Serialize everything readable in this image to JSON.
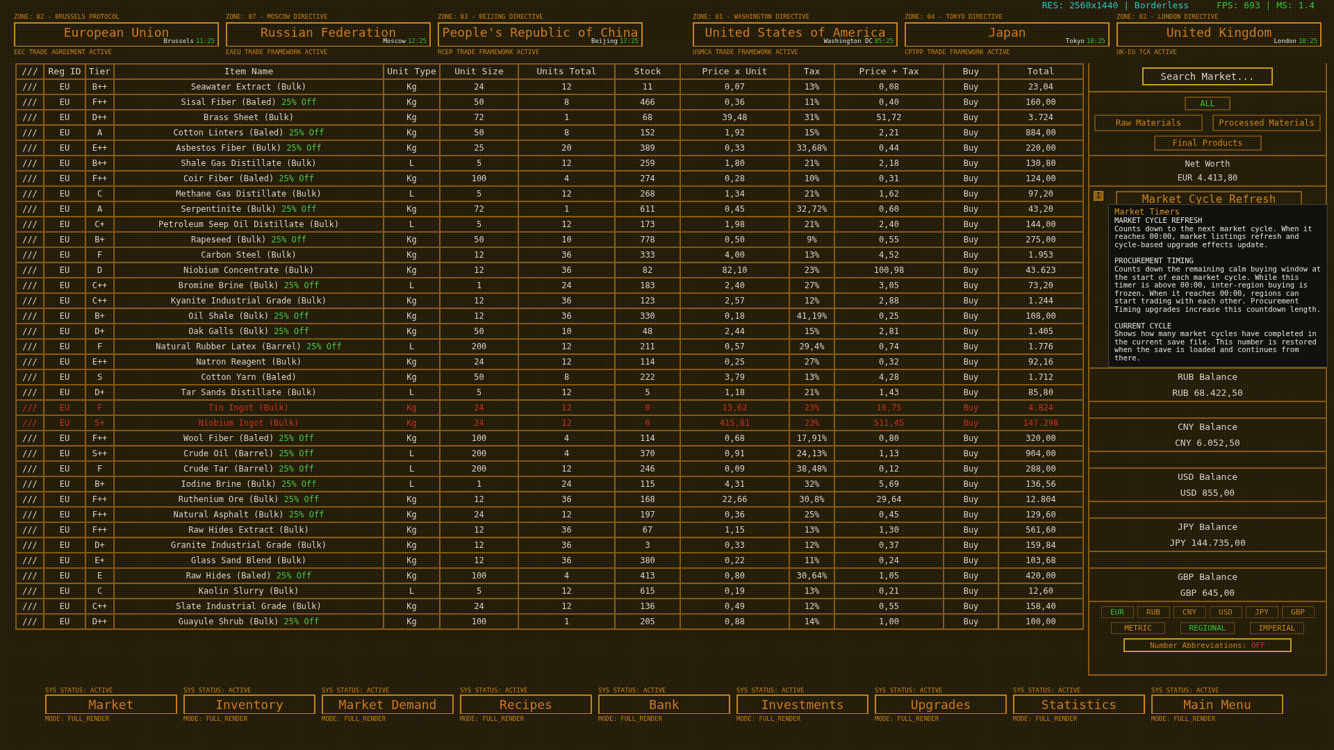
{
  "status": {
    "resolution": "RES: 2560x1440 | Borderless",
    "performance": "FPS: 693 | MS: 1.4"
  },
  "zones": [
    {
      "label": "ZONE: 02 - BRUSSELS PROTOCOL",
      "name": "European Union",
      "city": "Brussels",
      "time": "11:25",
      "agreement": "EEC TRADE AGREEMENT ACTIVE"
    },
    {
      "label": "ZONE: 07 - MOSCOW DIRECTIVE",
      "name": "Russian Federation",
      "city": "Moscow",
      "time": "12:25",
      "agreement": "EAEU TRADE FRAMEWORK ACTIVE"
    },
    {
      "label": "ZONE: 03 - BEIJING DIRECTIVE",
      "name": "People's Republic of China",
      "city": "Beijing",
      "time": "17:25",
      "agreement": "RCEP TRADE FRAMEWORK ACTIVE"
    },
    {
      "label": "ZONE: 01 - WASHINGTON DIRECTIVE",
      "name": "United States of America",
      "city": "Washington DC",
      "time": "05:25",
      "agreement": "USMCA TRADE FRAMEWORK ACTIVE"
    },
    {
      "label": "ZONE: 04 - TOKYO DIRECTIVE",
      "name": "Japan",
      "city": "Tokyo",
      "time": "18:25",
      "agreement": "CPTPP TRADE FRAMEWORK ACTIVE"
    },
    {
      "label": "ZONE: 02 - LONDON DIRECTIVE",
      "name": "United Kingdom",
      "city": "London",
      "time": "10:25",
      "agreement": "UK-EU TCA ACTIVE"
    }
  ],
  "table": {
    "columns": [
      "///",
      "Reg ID",
      "Tier",
      "Item Name",
      "Unit Type",
      "Unit Size",
      "Units Total",
      "Stock",
      "Price x Unit",
      "Tax",
      "Price + Tax",
      "Buy",
      "Total"
    ],
    "rows": [
      {
        "marker": "///",
        "region": "EU",
        "tier": "B++",
        "item": "Seawater Extract (Bulk)",
        "unit_type": "Kg",
        "unit_size": "24",
        "units_total": "12",
        "stock": "11",
        "price": "0,07",
        "tax": "13%",
        "price_tax": "0,08",
        "buy": "Buy",
        "total": "23,04",
        "out_of_stock": false
      },
      {
        "marker": "///",
        "region": "EU",
        "tier": "F++",
        "item": "Sisal Fiber (Baled)",
        "discount": "25% Off",
        "unit_type": "Kg",
        "unit_size": "50",
        "units_total": "8",
        "stock": "466",
        "price": "0,36",
        "tax": "11%",
        "price_tax": "0,40",
        "buy": "Buy",
        "total": "160,00",
        "out_of_stock": false
      },
      {
        "marker": "///",
        "region": "EU",
        "tier": "D++",
        "item": "Brass Sheet (Bulk)",
        "unit_type": "Kg",
        "unit_size": "72",
        "units_total": "1",
        "stock": "68",
        "price": "39,48",
        "tax": "31%",
        "price_tax": "51,72",
        "buy": "Buy",
        "total": "3.724",
        "out_of_stock": false
      },
      {
        "marker": "///",
        "region": "EU",
        "tier": "A",
        "item": "Cotton Linters (Baled)",
        "discount": "25% Off",
        "unit_type": "Kg",
        "unit_size": "50",
        "units_total": "8",
        "stock": "152",
        "price": "1,92",
        "tax": "15%",
        "price_tax": "2,21",
        "buy": "Buy",
        "total": "884,00",
        "out_of_stock": false
      },
      {
        "marker": "///",
        "region": "EU",
        "tier": "E++",
        "item": "Asbestos Fiber (Bulk)",
        "discount": "25% Off",
        "unit_type": "Kg",
        "unit_size": "25",
        "units_total": "20",
        "stock": "389",
        "price": "0,33",
        "tax": "33,68%",
        "price_tax": "0,44",
        "buy": "Buy",
        "total": "220,00",
        "out_of_stock": false
      },
      {
        "marker": "///",
        "region": "EU",
        "tier": "B++",
        "item": "Shale Gas Distillate (Bulk)",
        "unit_type": "L",
        "unit_size": "5",
        "units_total": "12",
        "stock": "259",
        "price": "1,80",
        "tax": "21%",
        "price_tax": "2,18",
        "buy": "Buy",
        "total": "130,80",
        "out_of_stock": false
      },
      {
        "marker": "///",
        "region": "EU",
        "tier": "F++",
        "item": "Coir Fiber (Baled)",
        "discount": "25% Off",
        "unit_type": "Kg",
        "unit_size": "100",
        "units_total": "4",
        "stock": "274",
        "price": "0,28",
        "tax": "10%",
        "price_tax": "0,31",
        "buy": "Buy",
        "total": "124,00",
        "out_of_stock": false
      },
      {
        "marker": "///",
        "region": "EU",
        "tier": "C",
        "item": "Methane Gas Distillate (Bulk)",
        "unit_type": "L",
        "unit_size": "5",
        "units_total": "12",
        "stock": "268",
        "price": "1,34",
        "tax": "21%",
        "price_tax": "1,62",
        "buy": "Buy",
        "total": "97,20",
        "out_of_stock": false
      },
      {
        "marker": "///",
        "region": "EU",
        "tier": "A",
        "item": "Serpentinite (Bulk)",
        "discount": "25% Off",
        "unit_type": "Kg",
        "unit_size": "72",
        "units_total": "1",
        "stock": "611",
        "price": "0,45",
        "tax": "32,72%",
        "price_tax": "0,60",
        "buy": "Buy",
        "total": "43,20",
        "out_of_stock": false
      },
      {
        "marker": "///",
        "region": "EU",
        "tier": "C+",
        "item": "Petroleum Seep Oil Distillate (Bulk)",
        "unit_type": "L",
        "unit_size": "5",
        "units_total": "12",
        "stock": "173",
        "price": "1,98",
        "tax": "21%",
        "price_tax": "2,40",
        "buy": "Buy",
        "total": "144,00",
        "out_of_stock": false
      },
      {
        "marker": "///",
        "region": "EU",
        "tier": "B+",
        "item": "Rapeseed (Bulk)",
        "discount": "25% Off",
        "unit_type": "Kg",
        "unit_size": "50",
        "units_total": "10",
        "stock": "778",
        "price": "0,50",
        "tax": "9%",
        "price_tax": "0,55",
        "buy": "Buy",
        "total": "275,00",
        "out_of_stock": false
      },
      {
        "marker": "///",
        "region": "EU",
        "tier": "F",
        "item": "Carbon Steel (Bulk)",
        "unit_type": "Kg",
        "unit_size": "12",
        "units_total": "36",
        "stock": "333",
        "price": "4,00",
        "tax": "13%",
        "price_tax": "4,52",
        "buy": "Buy",
        "total": "1.953",
        "out_of_stock": false
      },
      {
        "marker": "///",
        "region": "EU",
        "tier": "D",
        "item": "Niobium Concentrate (Bulk)",
        "unit_type": "Kg",
        "unit_size": "12",
        "units_total": "36",
        "stock": "82",
        "price": "82,10",
        "tax": "23%",
        "price_tax": "100,98",
        "buy": "Buy",
        "total": "43.623",
        "out_of_stock": false
      },
      {
        "marker": "///",
        "region": "EU",
        "tier": "C++",
        "item": "Bromine Brine (Bulk)",
        "discount": "25% Off",
        "unit_type": "L",
        "unit_size": "1",
        "units_total": "24",
        "stock": "183",
        "price": "2,40",
        "tax": "27%",
        "price_tax": "3,05",
        "buy": "Buy",
        "total": "73,20",
        "out_of_stock": false
      },
      {
        "marker": "///",
        "region": "EU",
        "tier": "C++",
        "item": "Kyanite Industrial Grade (Bulk)",
        "unit_type": "Kg",
        "unit_size": "12",
        "units_total": "36",
        "stock": "123",
        "price": "2,57",
        "tax": "12%",
        "price_tax": "2,88",
        "buy": "Buy",
        "total": "1.244",
        "out_of_stock": false
      },
      {
        "marker": "///",
        "region": "EU",
        "tier": "B+",
        "item": "Oil Shale (Bulk)",
        "discount": "25% Off",
        "unit_type": "Kg",
        "unit_size": "12",
        "units_total": "36",
        "stock": "330",
        "price": "0,18",
        "tax": "41,19%",
        "price_tax": "0,25",
        "buy": "Buy",
        "total": "108,00",
        "out_of_stock": false
      },
      {
        "marker": "///",
        "region": "EU",
        "tier": "D+",
        "item": "Oak Galls (Bulk)",
        "discount": "25% Off",
        "unit_type": "Kg",
        "unit_size": "50",
        "units_total": "10",
        "stock": "48",
        "price": "2,44",
        "tax": "15%",
        "price_tax": "2,81",
        "buy": "Buy",
        "total": "1.405",
        "out_of_stock": false
      },
      {
        "marker": "///",
        "region": "EU",
        "tier": "F",
        "item": "Natural Rubber Latex (Barrel)",
        "discount": "25% Off",
        "unit_type": "L",
        "unit_size": "200",
        "units_total": "12",
        "stock": "211",
        "price": "0,57",
        "tax": "29,4%",
        "price_tax": "0,74",
        "buy": "Buy",
        "total": "1.776",
        "out_of_stock": false
      },
      {
        "marker": "///",
        "region": "EU",
        "tier": "E++",
        "item": "Natron Reagent (Bulk)",
        "unit_type": "Kg",
        "unit_size": "24",
        "units_total": "12",
        "stock": "114",
        "price": "0,25",
        "tax": "27%",
        "price_tax": "0,32",
        "buy": "Buy",
        "total": "92,16",
        "out_of_stock": false
      },
      {
        "marker": "///",
        "region": "EU",
        "tier": "S",
        "item": "Cotton Yarn (Baled)",
        "unit_type": "Kg",
        "unit_size": "50",
        "units_total": "8",
        "stock": "222",
        "price": "3,79",
        "tax": "13%",
        "price_tax": "4,28",
        "buy": "Buy",
        "total": "1.712",
        "out_of_stock": false
      },
      {
        "marker": "///",
        "region": "EU",
        "tier": "D+",
        "item": "Tar Sands Distillate (Bulk)",
        "unit_type": "L",
        "unit_size": "5",
        "units_total": "12",
        "stock": "5",
        "price": "1,18",
        "tax": "21%",
        "price_tax": "1,43",
        "buy": "Buy",
        "total": "85,80",
        "out_of_stock": false
      },
      {
        "marker": "///",
        "region": "EU",
        "tier": "F",
        "item": "Tin Ingot (Bulk)",
        "unit_type": "Kg",
        "unit_size": "24",
        "units_total": "12",
        "stock": "0",
        "price": "13,62",
        "tax": "23%",
        "price_tax": "16,75",
        "buy": "Buy",
        "total": "4.824",
        "out_of_stock": true
      },
      {
        "marker": "///",
        "region": "EU",
        "tier": "S+",
        "item": "Niobium Ingot (Bulk)",
        "unit_type": "Kg",
        "unit_size": "24",
        "units_total": "12",
        "stock": "0",
        "price": "415,81",
        "tax": "23%",
        "price_tax": "511,45",
        "buy": "Buy",
        "total": "147.298",
        "out_of_stock": true
      },
      {
        "marker": "///",
        "region": "EU",
        "tier": "F++",
        "item": "Wool Fiber (Baled)",
        "discount": "25% Off",
        "unit_type": "Kg",
        "unit_size": "100",
        "units_total": "4",
        "stock": "114",
        "price": "0,68",
        "tax": "17,91%",
        "price_tax": "0,80",
        "buy": "Buy",
        "total": "320,00",
        "out_of_stock": false
      },
      {
        "marker": "///",
        "region": "EU",
        "tier": "S++",
        "item": "Crude Oil (Barrel)",
        "discount": "25% Off",
        "unit_type": "L",
        "unit_size": "200",
        "units_total": "4",
        "stock": "370",
        "price": "0,91",
        "tax": "24,13%",
        "price_tax": "1,13",
        "buy": "Buy",
        "total": "904,00",
        "out_of_stock": false
      },
      {
        "marker": "///",
        "region": "EU",
        "tier": "F",
        "item": "Crude Tar (Barrel)",
        "discount": "25% Off",
        "unit_type": "L",
        "unit_size": "200",
        "units_total": "12",
        "stock": "246",
        "price": "0,09",
        "tax": "38,48%",
        "price_tax": "0,12",
        "buy": "Buy",
        "total": "288,00",
        "out_of_stock": false
      },
      {
        "marker": "///",
        "region": "EU",
        "tier": "B+",
        "item": "Iodine Brine (Bulk)",
        "discount": "25% Off",
        "unit_type": "L",
        "unit_size": "1",
        "units_total": "24",
        "stock": "115",
        "price": "4,31",
        "tax": "32%",
        "price_tax": "5,69",
        "buy": "Buy",
        "total": "136,56",
        "out_of_stock": false
      },
      {
        "marker": "///",
        "region": "EU",
        "tier": "F++",
        "item": "Ruthenium Ore (Bulk)",
        "discount": "25% Off",
        "unit_type": "Kg",
        "unit_size": "12",
        "units_total": "36",
        "stock": "168",
        "price": "22,66",
        "tax": "30,8%",
        "price_tax": "29,64",
        "buy": "Buy",
        "total": "12.804",
        "out_of_stock": false
      },
      {
        "marker": "///",
        "region": "EU",
        "tier": "F++",
        "item": "Natural Asphalt (Bulk)",
        "discount": "25% Off",
        "unit_type": "Kg",
        "unit_size": "24",
        "units_total": "12",
        "stock": "197",
        "price": "0,36",
        "tax": "25%",
        "price_tax": "0,45",
        "buy": "Buy",
        "total": "129,60",
        "out_of_stock": false
      },
      {
        "marker": "///",
        "region": "EU",
        "tier": "F++",
        "item": "Raw Hides Extract (Bulk)",
        "unit_type": "Kg",
        "unit_size": "12",
        "units_total": "36",
        "stock": "67",
        "price": "1,15",
        "tax": "13%",
        "price_tax": "1,30",
        "buy": "Buy",
        "total": "561,60",
        "out_of_stock": false
      },
      {
        "marker": "///",
        "region": "EU",
        "tier": "D+",
        "item": "Granite Industrial Grade (Bulk)",
        "unit_type": "Kg",
        "unit_size": "12",
        "units_total": "36",
        "stock": "3",
        "price": "0,33",
        "tax": "12%",
        "price_tax": "0,37",
        "buy": "Buy",
        "total": "159,84",
        "out_of_stock": false
      },
      {
        "marker": "///",
        "region": "EU",
        "tier": "E+",
        "item": "Glass Sand Blend (Bulk)",
        "unit_type": "Kg",
        "unit_size": "12",
        "units_total": "36",
        "stock": "380",
        "price": "0,22",
        "tax": "11%",
        "price_tax": "0,24",
        "buy": "Buy",
        "total": "103,68",
        "out_of_stock": false
      },
      {
        "marker": "///",
        "region": "EU",
        "tier": "E",
        "item": "Raw Hides (Baled)",
        "discount": "25% Off",
        "unit_type": "Kg",
        "unit_size": "100",
        "units_total": "4",
        "stock": "413",
        "price": "0,80",
        "tax": "30,64%",
        "price_tax": "1,05",
        "buy": "Buy",
        "total": "420,00",
        "out_of_stock": false
      },
      {
        "marker": "///",
        "region": "EU",
        "tier": "C",
        "item": "Kaolin Slurry (Bulk)",
        "unit_type": "L",
        "unit_size": "5",
        "units_total": "12",
        "stock": "615",
        "price": "0,19",
        "tax": "13%",
        "price_tax": "0,21",
        "buy": "Buy",
        "total": "12,60",
        "out_of_stock": false
      },
      {
        "marker": "///",
        "region": "EU",
        "tier": "C++",
        "item": "Slate Industrial Grade (Bulk)",
        "unit_type": "Kg",
        "unit_size": "24",
        "units_total": "12",
        "stock": "136",
        "price": "0,49",
        "tax": "12%",
        "price_tax": "0,55",
        "buy": "Buy",
        "total": "158,40",
        "out_of_stock": false
      },
      {
        "marker": "///",
        "region": "EU",
        "tier": "D++",
        "item": "Guayule Shrub (Bulk)",
        "discount": "25% Off",
        "unit_type": "Kg",
        "unit_size": "100",
        "units_total": "1",
        "stock": "205",
        "price": "0,88",
        "tax": "14%",
        "price_tax": "1,00",
        "buy": "Buy",
        "total": "100,00",
        "out_of_stock": false
      }
    ]
  },
  "sidebar": {
    "search": {
      "placeholder": "Search Market..."
    },
    "filters": [
      {
        "label": "ALL",
        "selected": true
      },
      {
        "label": "Raw Materials",
        "selected": false
      },
      {
        "label": "Processed Materials",
        "selected": false
      },
      {
        "label": "Final Products",
        "selected": false
      }
    ],
    "net_worth": {
      "label": "Net Worth",
      "value": "EUR 4.413,80"
    },
    "info_button": "I",
    "cycle_button": "Market Cycle Refresh",
    "tooltip": {
      "title": "Market Timers",
      "sections": [
        {
          "heading": "MARKET CYCLE REFRESH",
          "body": "Counts down to the next market cycle. When it reaches 00:00, market listings refresh and cycle-based upgrade effects update."
        },
        {
          "heading": "PROCUREMENT TIMING",
          "body": "Counts down the remaining calm buying window at the start of each market cycle. While this timer is above 00:00, inter-region buying is frozen. When it reaches 00:00, regions can start trading with each other. Procurement Timing upgrades increase this countdown length."
        },
        {
          "heading": "CURRENT CYCLE",
          "body": "Shows how many market cycles have completed in the current save file. This number is restored when the save is loaded and continues from there."
        }
      ]
    },
    "balances": [
      {
        "label": "RUB Balance",
        "value": "RUB 68.422,50"
      },
      {
        "label": "CNY Balance",
        "value": "CNY 6.052,50"
      },
      {
        "label": "USD Balance",
        "value": "USD 855,00"
      },
      {
        "label": "JPY Balance",
        "value": "JPY 144.735,00"
      },
      {
        "label": "GBP Balance",
        "value": "GBP 645,00"
      }
    ],
    "currencies": [
      {
        "label": "EUR",
        "selected": true
      },
      {
        "label": "RUB",
        "selected": false
      },
      {
        "label": "CNY",
        "selected": false
      },
      {
        "label": "USD",
        "selected": false
      },
      {
        "label": "JPY",
        "selected": false
      },
      {
        "label": "GBP",
        "selected": false
      }
    ],
    "units": [
      {
        "label": "METRIC",
        "selected": false
      },
      {
        "label": "REGIONAL",
        "selected": true
      },
      {
        "label": "IMPERIAL",
        "selected": false
      }
    ],
    "abbreviations": {
      "label": "Number Abbreviations:",
      "value": "OFF",
      "on": false
    }
  },
  "nav": [
    {
      "status": "SYS STATUS: ACTIVE",
      "label": "Market",
      "mode": "MODE: FULL_RENDER"
    },
    {
      "status": "SYS STATUS: ACTIVE",
      "label": "Inventory",
      "mode": "MODE: FULL_RENDER"
    },
    {
      "status": "SYS STATUS: ACTIVE",
      "label": "Market Demand",
      "mode": "MODE: FULL_RENDER"
    },
    {
      "status": "SYS STATUS: ACTIVE",
      "label": "Recipes",
      "mode": "MODE: FULL_RENDER"
    },
    {
      "status": "SYS STATUS: ACTIVE",
      "label": "Bank",
      "mode": "MODE: FULL_RENDER"
    },
    {
      "status": "SYS STATUS: ACTIVE",
      "label": "Investments",
      "mode": "MODE: FULL_RENDER"
    },
    {
      "status": "SYS STATUS: ACTIVE",
      "label": "Upgrades",
      "mode": "MODE: FULL_RENDER"
    },
    {
      "status": "SYS STATUS: ACTIVE",
      "label": "Statistics",
      "mode": "MODE: FULL_RENDER"
    },
    {
      "status": "SYS STATUS: ACTIVE",
      "label": "Main Menu",
      "mode": "MODE: FULL_RENDER"
    }
  ]
}
